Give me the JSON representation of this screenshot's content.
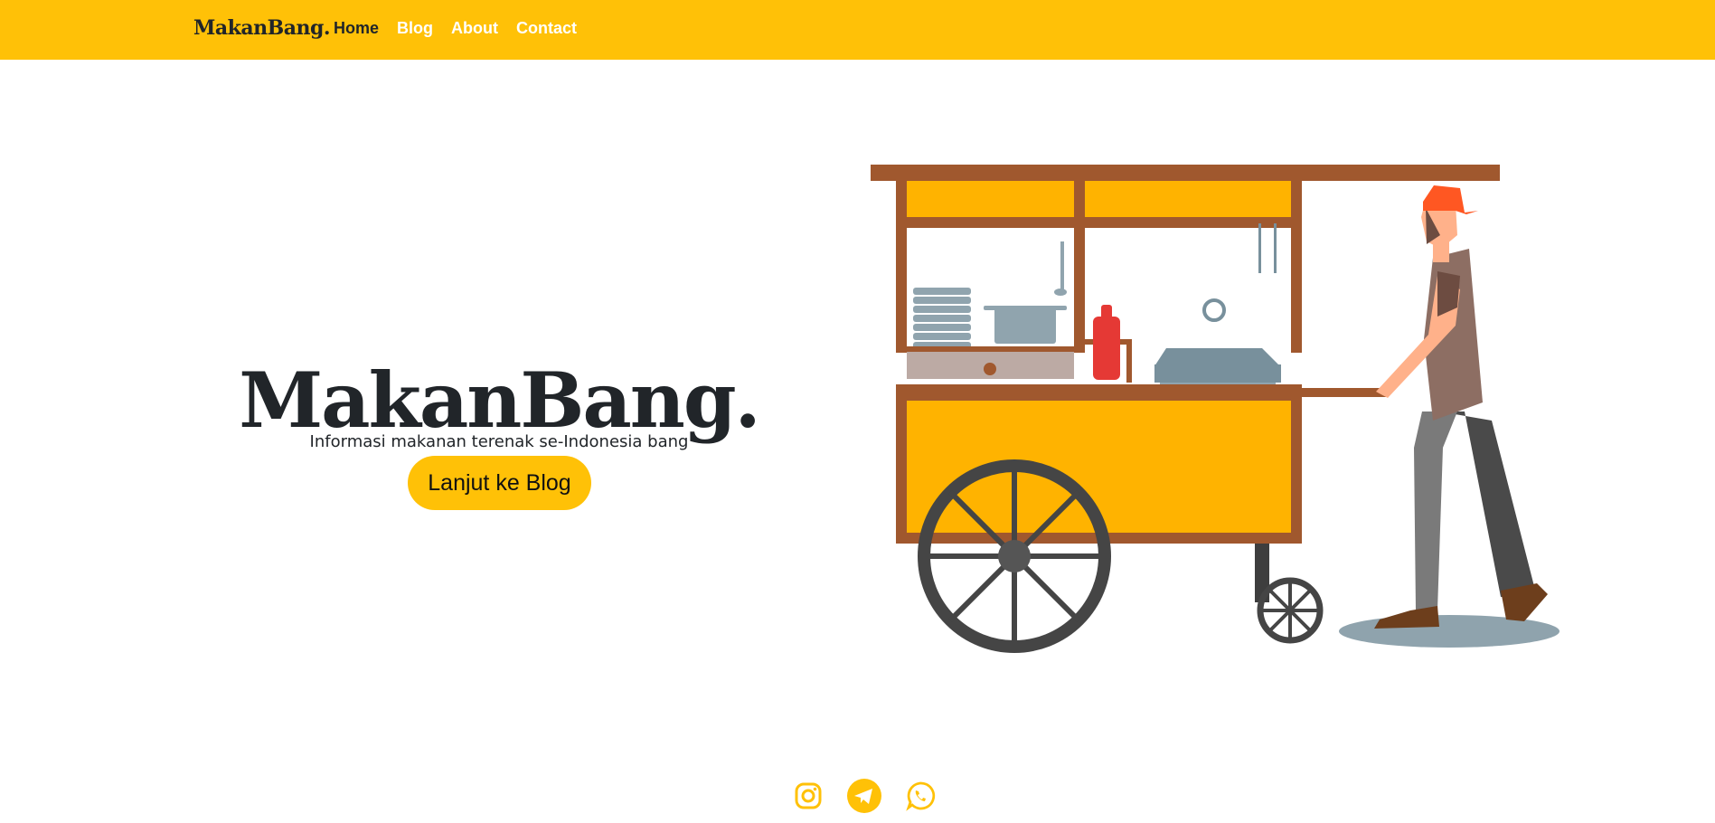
{
  "nav": {
    "brand": "MakanBang.",
    "links": [
      {
        "label": "Home",
        "active": true
      },
      {
        "label": "Blog",
        "active": false
      },
      {
        "label": "About",
        "active": false
      },
      {
        "label": "Contact",
        "active": false
      }
    ]
  },
  "hero": {
    "title": "MakanBang.",
    "subtitle": "Informasi makanan terenak se-Indonesia bang",
    "button_label": "Lanjut ke Blog",
    "illustration": "food-cart-vendor-illustration"
  },
  "social": {
    "icons": [
      "instagram-icon",
      "telegram-icon",
      "whatsapp-icon"
    ]
  },
  "colors": {
    "accent": "#ffc107",
    "text": "#212529",
    "cart_wood": "#a0582e",
    "cart_panel": "#ffb300",
    "wheel": "#454545"
  }
}
